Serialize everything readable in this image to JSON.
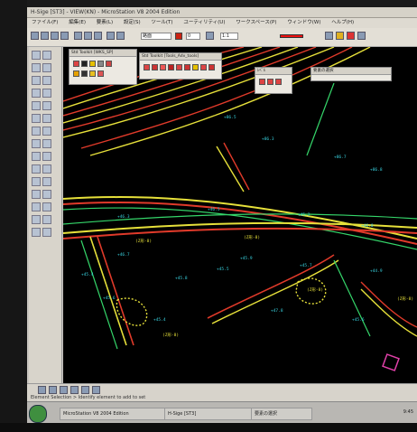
{
  "window": {
    "title": "H-Sige [ST3] - VIEW(KN) - MicroStation V8 2004 Edition"
  },
  "menu": [
    "ファイル(F)",
    "編集(E)",
    "要素(L)",
    "設定(S)",
    "ツール(T)",
    "ユーティリティ(U)",
    "ワークスペース(P)",
    "ウィンドウ(W)",
    "ヘルプ(H)"
  ],
  "toolbar": {
    "level_value": "路面",
    "weight_value": "0",
    "scale_value": "1:1"
  },
  "palettes": {
    "main": "Std Toolkit [WKS_SP]",
    "sub": "Std Toolkit [Tools_Adv_tools]",
    "small": "ﾚﾍﾞﾙ",
    "right": "要素の選択"
  },
  "drawing_labels": [
    "+86.5",
    "+86.3",
    "+86.7",
    "+86.8",
    "+46.3",
    "+46.5",
    "+45.2",
    "+46.0",
    "+45.6",
    "+45.8",
    "+45.9",
    "(Z形-8)",
    "(Z形-8)",
    "(Z形-8)",
    "+45.4",
    "+45.5",
    "+45.7",
    "+44.9",
    "+47.8",
    "+45.6",
    "+46.7",
    "(Z形-8)",
    "+45.4",
    "(Z形-8)"
  ],
  "status": {
    "message": "Element Selection > Identify element to add to set"
  },
  "taskbar": {
    "items": [
      "MicroStation V8 2004 Edition",
      "H-Sige [ST3]",
      "要素の選択"
    ],
    "clock": "9:45"
  },
  "colors": {
    "canvas_bg": "#000000",
    "contour_red": "#e03a2a",
    "contour_yellow": "#e6e03a",
    "road_green": "#35d66a",
    "text_cyan": "#39d3e0",
    "marker_magenta": "#e040a8"
  }
}
